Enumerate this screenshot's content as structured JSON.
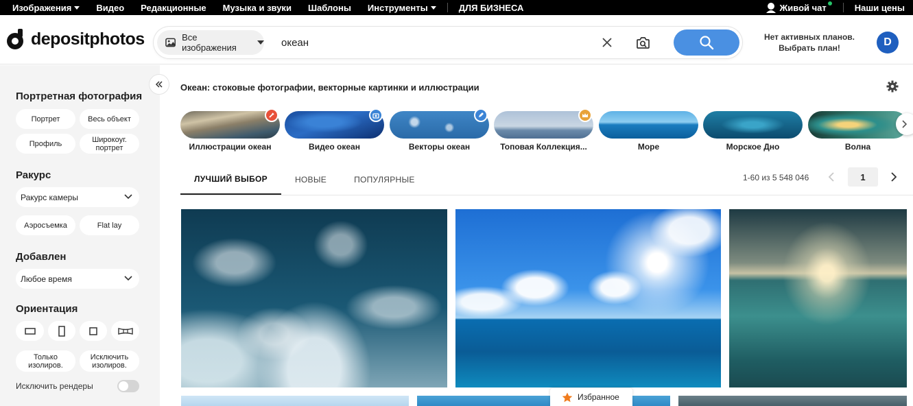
{
  "topnav": {
    "images": "Изображения",
    "video": "Видео",
    "editorial": "Редакционные",
    "music": "Музыка и звуки",
    "templates": "Шаблоны",
    "tools": "Инструменты",
    "business": "ДЛЯ БИЗНЕСА",
    "live_chat": "Живой чат",
    "prices": "Наши цены"
  },
  "header": {
    "logo_text": "depositphotos",
    "search_scope": "Все изображения",
    "search_value": "океан",
    "plan_line1": "Нет активных планов.",
    "plan_line2": "Выбрать план!",
    "avatar_letter": "D"
  },
  "sidebar": {
    "portrait_title": "Портретная фотография",
    "portrait_chips": [
      "Портрет",
      "Весь объект",
      "Профиль",
      "Широкоуг. портрет"
    ],
    "angle_title": "Ракурс",
    "angle_select": "Ракурс камеры",
    "angle_chips": [
      "Аэросъемка",
      "Flat lay"
    ],
    "added_title": "Добавлен",
    "added_select": "Любое время",
    "orientation_title": "Ориентация",
    "orientation_chips": [
      "Только изолиров.",
      "Исключить изолиров."
    ],
    "exclude_renders": "Исключить рендеры"
  },
  "main": {
    "page_title": "Океан: стоковые фотографии, векторные картинки и иллюстрации",
    "categories": [
      {
        "label": "Иллюстрации океан",
        "badge_color": "#e8513a"
      },
      {
        "label": "Видео океан",
        "badge_color": "#3b84d6"
      },
      {
        "label": "Векторы океан",
        "badge_color": "#3b84d6"
      },
      {
        "label": "Топовая Коллекция...",
        "badge_color": "#e8a33a"
      },
      {
        "label": "Море"
      },
      {
        "label": "Морское Дно"
      },
      {
        "label": "Волна"
      }
    ],
    "tabs": [
      "ЛУЧШИЙ ВЫБОР",
      "НОВЫЕ",
      "ПОПУЛЯРНЫЕ"
    ],
    "results_count": "1-60 из 5 548 046",
    "page_number": "1",
    "favorites": "Избранное"
  },
  "colors": {
    "accent": "#4a90e2",
    "avatar": "#1f5fbf"
  }
}
